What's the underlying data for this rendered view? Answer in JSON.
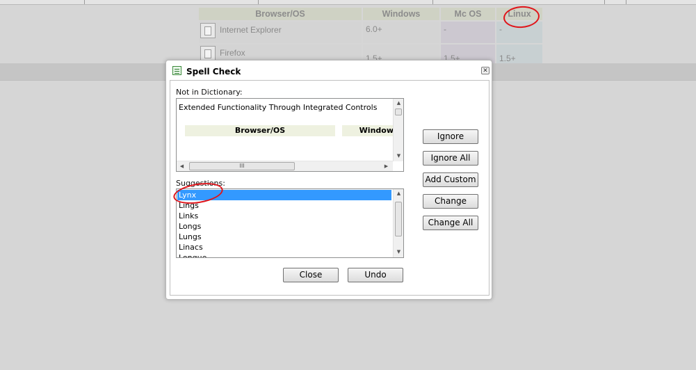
{
  "background": {
    "table": {
      "headers": [
        "Browser/OS",
        "Windows",
        "Mc OS",
        "Linux"
      ],
      "rows": [
        {
          "name": "Internet Explorer",
          "windows": "6.0+",
          "mac": "-",
          "linux": "-"
        },
        {
          "name": "Firefox",
          "windows": "1.5+",
          "mac": "1.5+",
          "linux": "1.5+"
        }
      ]
    },
    "annotation_color": "#e0141a"
  },
  "dialog": {
    "title": "Spell Check",
    "close_icon": "close-icon",
    "not_in_dictionary_label": "Not in Dictionary:",
    "preview_text": "Extended Functionality Through Integrated Controls",
    "preview_cells": [
      "Browser/OS",
      "Window"
    ],
    "hscroll_grip": "III",
    "suggestions_label": "Suggestions:",
    "suggestions": [
      "Lynx",
      "Lings",
      "Links",
      "Longs",
      "Lungs",
      "Linacs",
      "Lonque"
    ],
    "selected_suggestion": "Lynx",
    "selection_color": "#3399ff",
    "buttons": {
      "ignore": "Ignore",
      "ignore_all": "Ignore All",
      "add_custom": "Add Custom",
      "change": "Change",
      "change_all": "Change All",
      "close": "Close",
      "undo": "Undo"
    }
  }
}
